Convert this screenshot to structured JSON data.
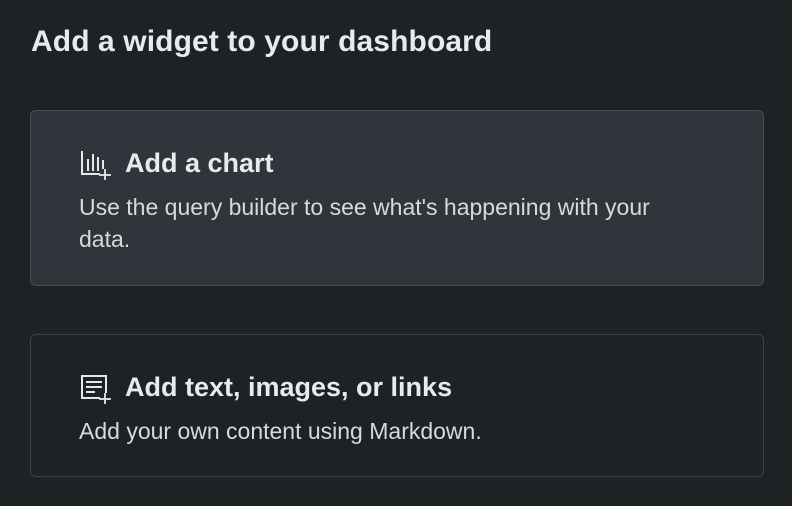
{
  "page": {
    "title": "Add a widget to your dashboard"
  },
  "widgets": [
    {
      "title": "Add a chart",
      "description": "Use the query builder to see what's happening with your data.",
      "icon": "chart-add-icon"
    },
    {
      "title": "Add text, images, or links",
      "description": "Add your own content using Markdown.",
      "icon": "markdown-add-icon"
    }
  ],
  "colors": {
    "background": "#1d2225",
    "card_hover_background": "#2f353b",
    "card_border": "#3b4247",
    "text_primary": "#e8eaec",
    "text_secondary": "#d7dadc"
  }
}
